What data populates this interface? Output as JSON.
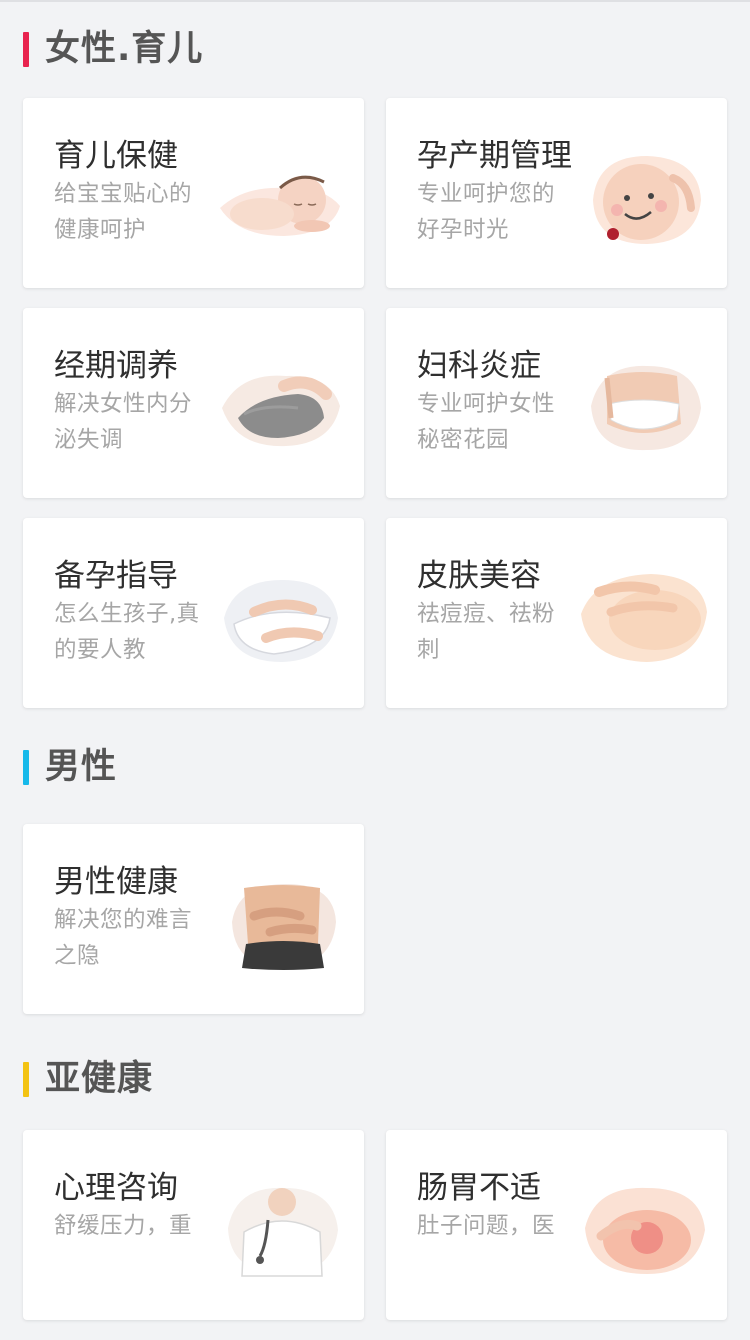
{
  "sections": [
    {
      "title": "女性.育儿",
      "bar_color": "#e8234e",
      "cards": [
        {
          "title": "育儿保健",
          "desc": "给宝宝贴心的健康呵护",
          "icon": "sleeping-baby-icon"
        },
        {
          "title": "孕产期管理",
          "desc": "专业呵护您的好孕时光",
          "icon": "pregnant-belly-icon"
        },
        {
          "title": "经期调养",
          "desc": "解决女性内分泌失调",
          "icon": "menstrual-care-icon"
        },
        {
          "title": "妇科炎症",
          "desc": "专业呵护女性秘密花园",
          "icon": "gynecology-icon"
        },
        {
          "title": "备孕指导",
          "desc": "怎么生孩子,真的要人教",
          "icon": "pregnancy-prep-icon"
        },
        {
          "title": "皮肤美容",
          "desc": "祛痘痘、祛粉刺",
          "icon": "skin-care-icon"
        }
      ]
    },
    {
      "title": "男性",
      "bar_color": "#16b9ea",
      "cards": [
        {
          "title": "男性健康",
          "desc": "解决您的难言之隐",
          "icon": "male-health-icon"
        }
      ]
    },
    {
      "title": "亚健康",
      "bar_color": "#f3c313",
      "cards": [
        {
          "title": "心理咨询",
          "desc": "舒缓压力，重",
          "icon": "doctor-icon"
        },
        {
          "title": "肠胃不适",
          "desc": "肚子问题，医",
          "icon": "stomach-icon"
        }
      ]
    }
  ]
}
